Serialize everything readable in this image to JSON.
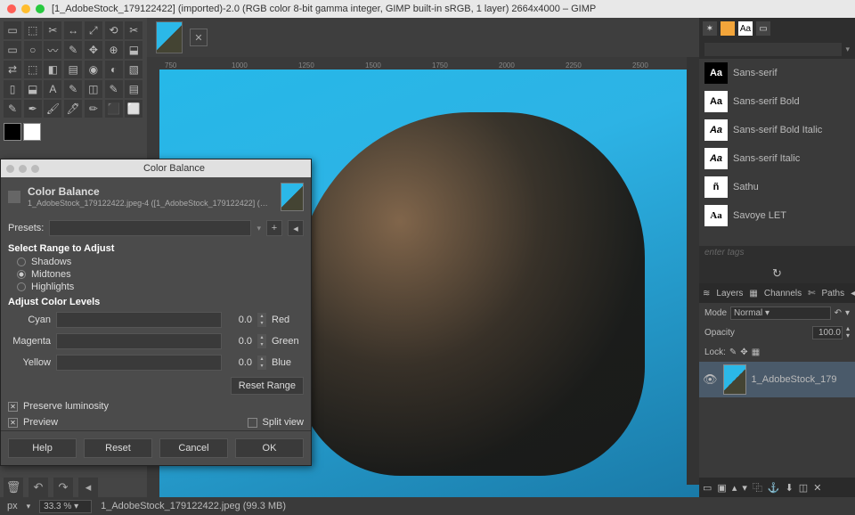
{
  "titlebar": {
    "title": "[1_AdobeStock_179122422] (imported)-2.0 (RGB color 8-bit gamma integer, GIMP built-in sRGB, 1 layer) 2664x4000 – GIMP"
  },
  "ruler_marks": [
    "750",
    "1000",
    "1250",
    "1500",
    "1750",
    "2000",
    "2250",
    "2500"
  ],
  "statusbar": {
    "unit": "px",
    "zoom": "33.3 %",
    "filename": "1_AdobeStock_179122422.jpeg (99.3 MB)"
  },
  "fonts": [
    {
      "swatch": "Aa",
      "name": "Sans-serif",
      "style": ""
    },
    {
      "swatch": "Aa",
      "name": "Sans-serif Bold",
      "style": "bold"
    },
    {
      "swatch": "Aa",
      "name": "Sans-serif Bold Italic",
      "style": "bold-italic"
    },
    {
      "swatch": "Aa",
      "name": "Sans-serif Italic",
      "style": "italic"
    },
    {
      "swatch": "ñ",
      "name": "Sathu",
      "style": ""
    },
    {
      "swatch": "Aa",
      "name": "Savoye LET",
      "style": "script"
    }
  ],
  "font_filter_placeholder": "",
  "tags_placeholder": "enter tags",
  "layers_panel": {
    "tabs": [
      "Layers",
      "Channels",
      "Paths"
    ],
    "mode_label": "Mode",
    "mode_value": "Normal",
    "opacity_label": "Opacity",
    "opacity_value": "100.0",
    "lock_label": "Lock:",
    "layer_name": "1_AdobeStock_179"
  },
  "dialog": {
    "window_title": "Color Balance",
    "header_title": "Color Balance",
    "header_sub": "1_AdobeStock_179122422.jpeg-4 ([1_AdobeStock_179122422] (…",
    "presets_label": "Presets:",
    "range_label": "Select Range to Adjust",
    "ranges": [
      "Shadows",
      "Midtones",
      "Highlights"
    ],
    "selected_range": "Midtones",
    "levels_label": "Adjust Color Levels",
    "sliders": [
      {
        "left": "Cyan",
        "value": "0.0",
        "right": "Red"
      },
      {
        "left": "Magenta",
        "value": "0.0",
        "right": "Green"
      },
      {
        "left": "Yellow",
        "value": "0.0",
        "right": "Blue"
      }
    ],
    "reset_range": "Reset Range",
    "preserve_label": "Preserve luminosity",
    "preview_label": "Preview",
    "split_label": "Split view",
    "buttons": [
      "Help",
      "Reset",
      "Cancel",
      "OK"
    ]
  }
}
